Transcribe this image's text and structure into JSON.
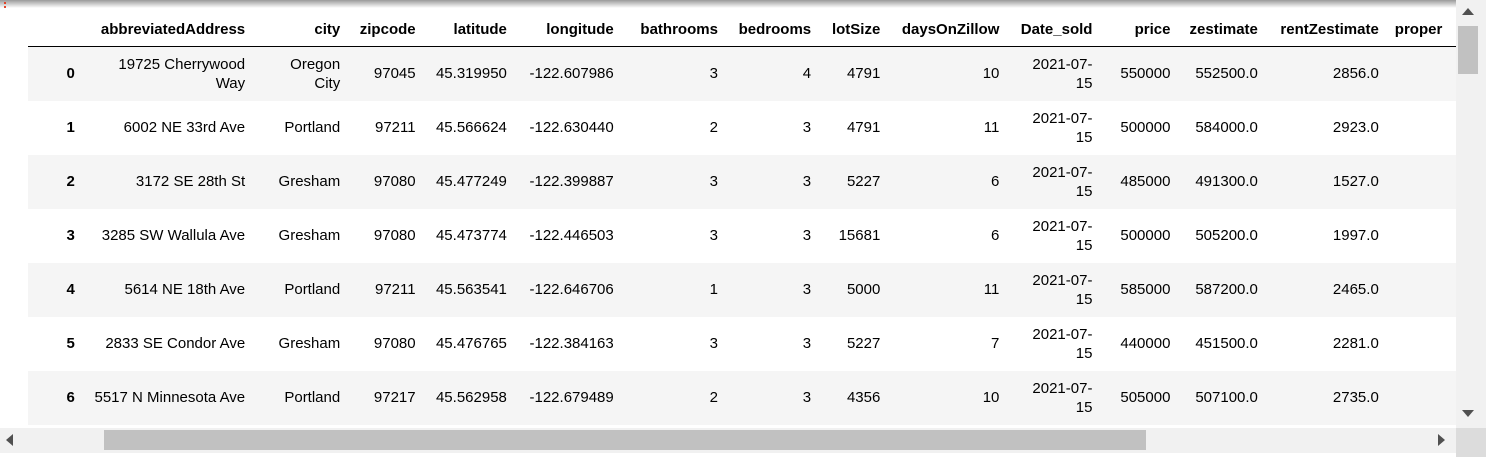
{
  "table": {
    "columns": [
      "",
      "abbreviatedAddress",
      "city",
      "zipcode",
      "latitude",
      "longitude",
      "bathrooms",
      "bedrooms",
      "lotSize",
      "daysOnZillow",
      "Date_sold",
      "price",
      "zestimate",
      "rentZestimate",
      "proper"
    ],
    "rows": [
      [
        "0",
        "19725 Cherrywood Way",
        "Oregon City",
        "97045",
        "45.319950",
        "-122.607986",
        "3",
        "4",
        "4791",
        "10",
        "2021-07-15",
        "550000",
        "552500.0",
        "2856.0",
        ""
      ],
      [
        "1",
        "6002 NE 33rd Ave",
        "Portland",
        "97211",
        "45.566624",
        "-122.630440",
        "2",
        "3",
        "4791",
        "11",
        "2021-07-15",
        "500000",
        "584000.0",
        "2923.0",
        ""
      ],
      [
        "2",
        "3172 SE 28th St",
        "Gresham",
        "97080",
        "45.477249",
        "-122.399887",
        "3",
        "3",
        "5227",
        "6",
        "2021-07-15",
        "485000",
        "491300.0",
        "1527.0",
        ""
      ],
      [
        "3",
        "3285 SW Wallula Ave",
        "Gresham",
        "97080",
        "45.473774",
        "-122.446503",
        "3",
        "3",
        "15681",
        "6",
        "2021-07-15",
        "500000",
        "505200.0",
        "1997.0",
        ""
      ],
      [
        "4",
        "5614 NE 18th Ave",
        "Portland",
        "97211",
        "45.563541",
        "-122.646706",
        "1",
        "3",
        "5000",
        "11",
        "2021-07-15",
        "585000",
        "587200.0",
        "2465.0",
        ""
      ],
      [
        "5",
        "2833 SE Condor Ave",
        "Gresham",
        "97080",
        "45.476765",
        "-122.384163",
        "3",
        "3",
        "5227",
        "7",
        "2021-07-15",
        "440000",
        "451500.0",
        "2281.0",
        ""
      ],
      [
        "6",
        "5517 N Minnesota Ave",
        "Portland",
        "97217",
        "45.562958",
        "-122.679489",
        "2",
        "3",
        "4356",
        "10",
        "2021-07-15",
        "505000",
        "507100.0",
        "2735.0",
        ""
      ]
    ]
  },
  "scrollbars": {
    "vertical_position": 0.0,
    "horizontal_position": 0.0
  }
}
